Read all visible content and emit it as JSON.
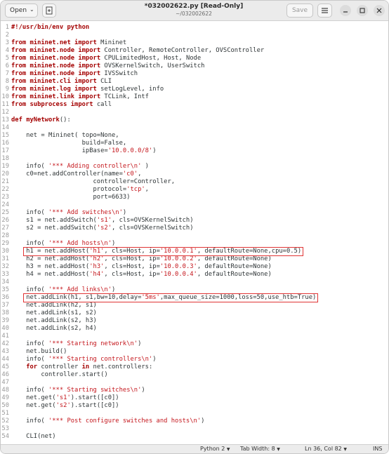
{
  "header": {
    "open_label": "Open",
    "title": "*032002622.py [Read-Only]",
    "subtitle": "~/032002622",
    "save_label": "Save"
  },
  "code_lines": [
    [
      {
        "t": "#!/usr/bin/env python",
        "c": "kw"
      }
    ],
    [],
    [
      {
        "t": "from ",
        "c": "kw"
      },
      {
        "t": "mininet.net ",
        "c": "kw"
      },
      {
        "t": "import ",
        "c": "kw"
      },
      {
        "t": "Mininet",
        "c": ""
      }
    ],
    [
      {
        "t": "from ",
        "c": "kw"
      },
      {
        "t": "mininet.node ",
        "c": "kw"
      },
      {
        "t": "import ",
        "c": "kw"
      },
      {
        "t": "Controller, RemoteController, OVSController",
        "c": ""
      }
    ],
    [
      {
        "t": "from ",
        "c": "kw"
      },
      {
        "t": "mininet.node ",
        "c": "kw"
      },
      {
        "t": "import ",
        "c": "kw"
      },
      {
        "t": "CPULimitedHost, Host, Node",
        "c": ""
      }
    ],
    [
      {
        "t": "from ",
        "c": "kw"
      },
      {
        "t": "mininet.node ",
        "c": "kw"
      },
      {
        "t": "import ",
        "c": "kw"
      },
      {
        "t": "OVSKernelSwitch, UserSwitch",
        "c": ""
      }
    ],
    [
      {
        "t": "from ",
        "c": "kw"
      },
      {
        "t": "mininet.node ",
        "c": "kw"
      },
      {
        "t": "import ",
        "c": "kw"
      },
      {
        "t": "IVSSwitch",
        "c": ""
      }
    ],
    [
      {
        "t": "from ",
        "c": "kw"
      },
      {
        "t": "mininet.cli ",
        "c": "kw"
      },
      {
        "t": "import ",
        "c": "kw"
      },
      {
        "t": "CLI",
        "c": ""
      }
    ],
    [
      {
        "t": "from ",
        "c": "kw"
      },
      {
        "t": "mininet.log ",
        "c": "kw"
      },
      {
        "t": "import ",
        "c": "kw"
      },
      {
        "t": "setLogLevel, info",
        "c": ""
      }
    ],
    [
      {
        "t": "from ",
        "c": "kw"
      },
      {
        "t": "mininet.link ",
        "c": "kw"
      },
      {
        "t": "import ",
        "c": "kw"
      },
      {
        "t": "TCLink, Intf",
        "c": ""
      }
    ],
    [
      {
        "t": "from ",
        "c": "kw"
      },
      {
        "t": "subprocess ",
        "c": "kw"
      },
      {
        "t": "import ",
        "c": "kw"
      },
      {
        "t": "call",
        "c": ""
      }
    ],
    [],
    [
      {
        "t": "def ",
        "c": "kw"
      },
      {
        "t": "myNetwork",
        "c": "fn"
      },
      {
        "t": "():",
        "c": ""
      }
    ],
    [],
    [
      {
        "t": "    net = Mininet( topo=None,",
        "c": ""
      }
    ],
    [
      {
        "t": "                   build=False,",
        "c": ""
      }
    ],
    [
      {
        "t": "                   ipBase=",
        "c": ""
      },
      {
        "t": "'10.0.0.0/8'",
        "c": "str"
      },
      {
        "t": ")",
        "c": ""
      }
    ],
    [],
    [
      {
        "t": "    info( ",
        "c": ""
      },
      {
        "t": "'*** Adding controller\\n'",
        "c": "str"
      },
      {
        "t": " )",
        "c": ""
      }
    ],
    [
      {
        "t": "    c0=net.addController(name=",
        "c": ""
      },
      {
        "t": "'c0'",
        "c": "str"
      },
      {
        "t": ",",
        "c": ""
      }
    ],
    [
      {
        "t": "                      controller=Controller,",
        "c": ""
      }
    ],
    [
      {
        "t": "                      protocol=",
        "c": ""
      },
      {
        "t": "'tcp'",
        "c": "str"
      },
      {
        "t": ",",
        "c": ""
      }
    ],
    [
      {
        "t": "                      port=6633)",
        "c": ""
      }
    ],
    [],
    [
      {
        "t": "    info( ",
        "c": ""
      },
      {
        "t": "'*** Add switches\\n'",
        "c": "str"
      },
      {
        "t": ")",
        "c": ""
      }
    ],
    [
      {
        "t": "    s1 = net.addSwitch(",
        "c": ""
      },
      {
        "t": "'s1'",
        "c": "str"
      },
      {
        "t": ", cls=OVSKernelSwitch)",
        "c": ""
      }
    ],
    [
      {
        "t": "    s2 = net.addSwitch(",
        "c": ""
      },
      {
        "t": "'s2'",
        "c": "str"
      },
      {
        "t": ", cls=OVSKernelSwitch)",
        "c": ""
      }
    ],
    [],
    [
      {
        "t": "    info( ",
        "c": ""
      },
      {
        "t": "'*** Add hosts\\n'",
        "c": "str"
      },
      {
        "t": ")",
        "c": ""
      }
    ],
    [
      {
        "t": "    h1 = net.addHost(",
        "c": ""
      },
      {
        "t": "'h1'",
        "c": "str"
      },
      {
        "t": ", cls=Host, ip=",
        "c": ""
      },
      {
        "t": "'10.0.0.1'",
        "c": "str"
      },
      {
        "t": ", defaultRoute=None,cpu=0.5)",
        "c": ""
      }
    ],
    [
      {
        "t": "    h2 = net.addHost(",
        "c": ""
      },
      {
        "t": "'h2'",
        "c": "str"
      },
      {
        "t": ", cls=Host, ip=",
        "c": ""
      },
      {
        "t": "'10.0.0.2'",
        "c": "str"
      },
      {
        "t": ", defaultRoute=None)",
        "c": ""
      }
    ],
    [
      {
        "t": "    h3 = net.addHost(",
        "c": ""
      },
      {
        "t": "'h3'",
        "c": "str"
      },
      {
        "t": ", cls=Host, ip=",
        "c": ""
      },
      {
        "t": "'10.0.0.3'",
        "c": "str"
      },
      {
        "t": ", defaultRoute=None)",
        "c": ""
      }
    ],
    [
      {
        "t": "    h4 = net.addHost(",
        "c": ""
      },
      {
        "t": "'h4'",
        "c": "str"
      },
      {
        "t": ", cls=Host, ip=",
        "c": ""
      },
      {
        "t": "'10.0.0.4'",
        "c": "str"
      },
      {
        "t": ", defaultRoute=None)",
        "c": ""
      }
    ],
    [],
    [
      {
        "t": "    info( ",
        "c": ""
      },
      {
        "t": "'*** Add links\\n'",
        "c": "str"
      },
      {
        "t": ")",
        "c": ""
      }
    ],
    [
      {
        "t": "    net.addLink(h1, s1,bw=10,delay=",
        "c": ""
      },
      {
        "t": "'5ms'",
        "c": "str"
      },
      {
        "t": ",max_queue_size=1000,loss=50,use_htb=True)",
        "c": ""
      }
    ],
    [
      {
        "t": "    net.addLink(h2, s1)",
        "c": ""
      }
    ],
    [
      {
        "t": "    net.addLink(s1, s2)",
        "c": ""
      }
    ],
    [
      {
        "t": "    net.addLink(s2, h3)",
        "c": ""
      }
    ],
    [
      {
        "t": "    net.addLink(s2, h4)",
        "c": ""
      }
    ],
    [],
    [
      {
        "t": "    info( ",
        "c": ""
      },
      {
        "t": "'*** Starting network\\n'",
        "c": "str"
      },
      {
        "t": ")",
        "c": ""
      }
    ],
    [
      {
        "t": "    net.build()",
        "c": ""
      }
    ],
    [
      {
        "t": "    info( ",
        "c": ""
      },
      {
        "t": "'*** Starting controllers\\n'",
        "c": "str"
      },
      {
        "t": ")",
        "c": ""
      }
    ],
    [
      {
        "t": "    ",
        "c": ""
      },
      {
        "t": "for ",
        "c": "kw"
      },
      {
        "t": "controller ",
        "c": ""
      },
      {
        "t": "in ",
        "c": "kw"
      },
      {
        "t": "net.controllers:",
        "c": ""
      }
    ],
    [
      {
        "t": "        controller.start()",
        "c": ""
      }
    ],
    [],
    [
      {
        "t": "    info( ",
        "c": ""
      },
      {
        "t": "'*** Starting switches\\n'",
        "c": "str"
      },
      {
        "t": ")",
        "c": ""
      }
    ],
    [
      {
        "t": "    net.get(",
        "c": ""
      },
      {
        "t": "'s1'",
        "c": "str"
      },
      {
        "t": ").start([c0])",
        "c": ""
      }
    ],
    [
      {
        "t": "    net.get(",
        "c": ""
      },
      {
        "t": "'s2'",
        "c": "str"
      },
      {
        "t": ").start([c0])",
        "c": ""
      }
    ],
    [],
    [
      {
        "t": "    info( ",
        "c": ""
      },
      {
        "t": "'*** Post configure switches and hosts\\n'",
        "c": "str"
      },
      {
        "t": ")",
        "c": ""
      }
    ],
    [],
    [
      {
        "t": "    CLI(net)",
        "c": ""
      }
    ]
  ],
  "highlighted_lines": [
    30,
    36
  ],
  "statusbar": {
    "language": "Python 2",
    "tab_width": "Tab Width: 8",
    "position": "Ln 36, Col 82",
    "mode": "INS"
  },
  "colors": {
    "keyword": "#a40000",
    "string": "#c4161c",
    "highlight_border": "#e03434"
  }
}
